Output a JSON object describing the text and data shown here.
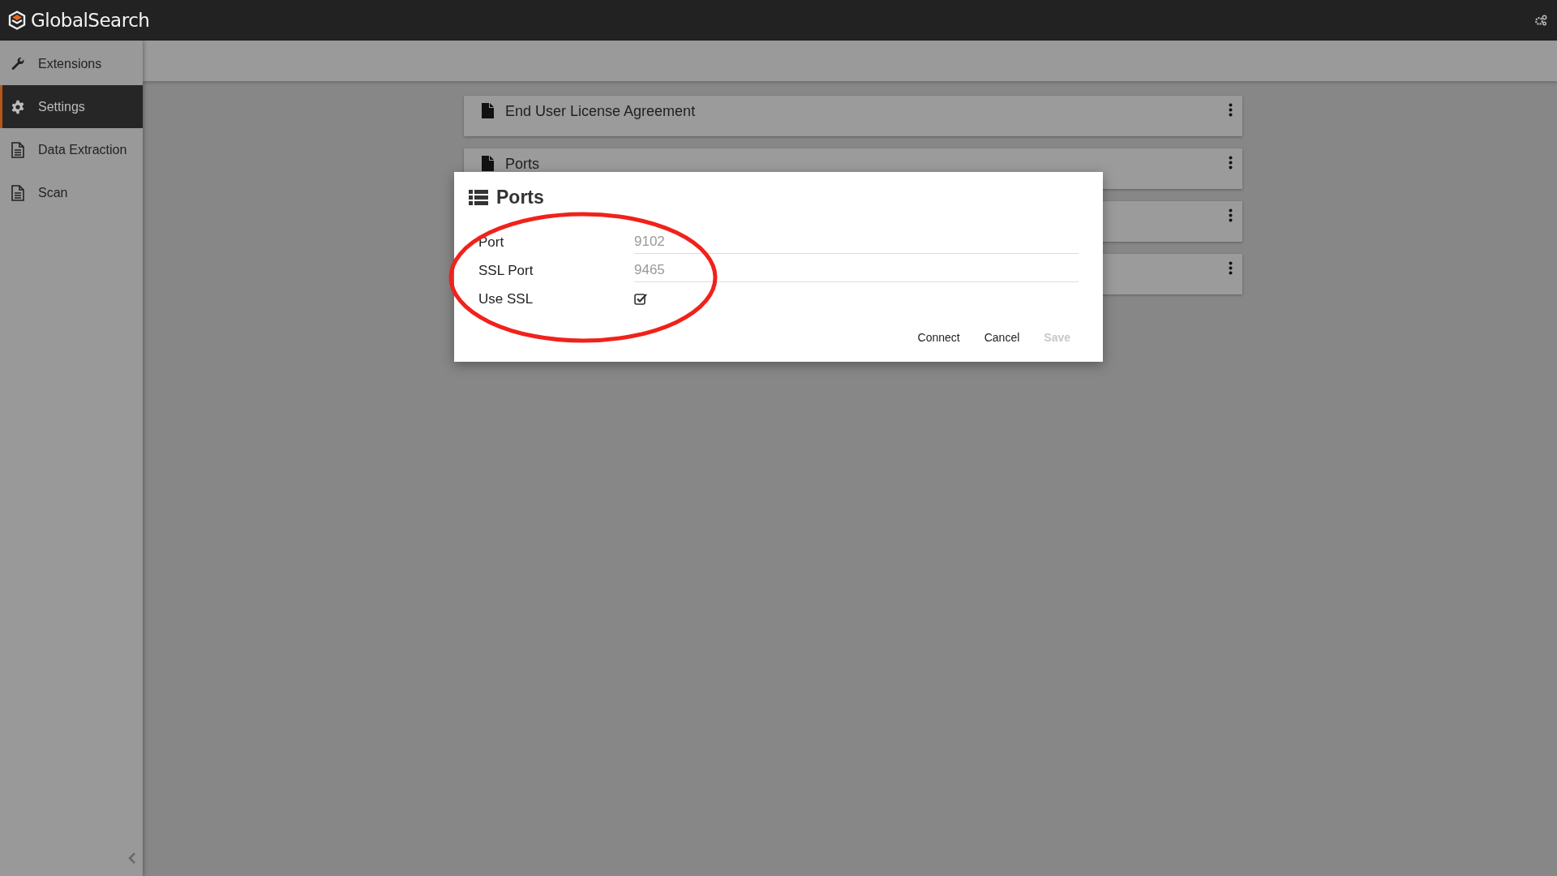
{
  "app": {
    "title": "GlobalSearch"
  },
  "sidebar": {
    "items": [
      {
        "label": "Extensions",
        "kind": "wrench",
        "selected": false
      },
      {
        "label": "Settings",
        "kind": "gear",
        "selected": true
      },
      {
        "label": "Data Extraction",
        "kind": "document",
        "selected": false
      },
      {
        "label": "Scan",
        "kind": "document",
        "selected": false
      }
    ]
  },
  "cards": [
    {
      "kind": "titled",
      "title": "End User License Agreement"
    },
    {
      "kind": "titled",
      "title": "Ports"
    },
    {
      "kind": "covered"
    },
    {
      "kind": "covered"
    }
  ],
  "dialog": {
    "title": "Ports",
    "fields": [
      {
        "kind": "text",
        "label": "Port",
        "value": "9102"
      },
      {
        "kind": "text",
        "label": "SSL Port",
        "value": "9465"
      },
      {
        "kind": "checkbox",
        "label": "Use SSL",
        "checked": true
      }
    ],
    "buttons": [
      {
        "label": "Connect",
        "disabled": false
      },
      {
        "label": "Cancel",
        "disabled": false
      },
      {
        "label": "Save",
        "disabled": true
      }
    ]
  }
}
